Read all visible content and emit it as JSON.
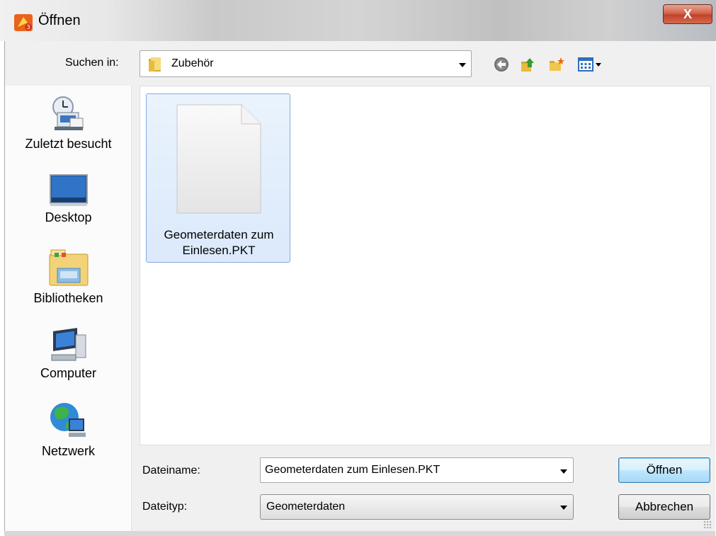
{
  "window": {
    "title": "Öffnen",
    "close_label": "X"
  },
  "lookin": {
    "label": "Suchen in:",
    "value": "Zubehör"
  },
  "toolbar_icons": [
    "back-icon",
    "up-folder-icon",
    "new-folder-icon",
    "view-menu-icon"
  ],
  "places": [
    {
      "label": "Zuletzt besucht",
      "icon": "recent-places-icon"
    },
    {
      "label": "Desktop",
      "icon": "desktop-icon"
    },
    {
      "label": "Bibliotheken",
      "icon": "libraries-icon"
    },
    {
      "label": "Computer",
      "icon": "computer-icon"
    },
    {
      "label": "Netzwerk",
      "icon": "network-icon"
    }
  ],
  "files": [
    {
      "name_line1": "Geometerdaten zum",
      "name_line2": "Einlesen.PKT",
      "icon": "document-icon",
      "selected": true
    }
  ],
  "filename": {
    "label": "Dateiname:",
    "value": "Geometerdaten zum Einlesen.PKT"
  },
  "filetype": {
    "label": "Dateityp:",
    "value": "Geometerdaten"
  },
  "buttons": {
    "open": "Öffnen",
    "cancel": "Abbrechen"
  },
  "colors": {
    "selection_fill": "#dbe9fb",
    "selection_border": "#84acdd",
    "default_button": "#bee6fd",
    "close_button": "#c0432a"
  }
}
